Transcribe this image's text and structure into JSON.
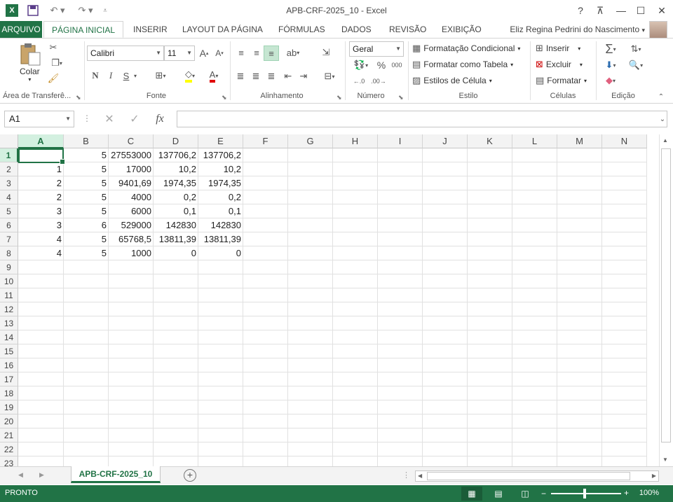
{
  "window": {
    "title": "APB-CRF-2025_10 - Excel",
    "help": "?",
    "restore_ribbon": "⊼",
    "minimize": "—",
    "maximize": "☐",
    "close": "✕"
  },
  "quick_access": {
    "save_icon": "save-icon",
    "undo_icon": "undo-icon",
    "redo_icon": "redo-icon"
  },
  "tabs": {
    "arquivo": "ARQUIVO",
    "items": [
      "PÁGINA INICIAL",
      "INSERIR",
      "LAYOUT DA PÁGINA",
      "FÓRMULAS",
      "DADOS",
      "REVISÃO",
      "EXIBIÇÃO"
    ],
    "user": "Eliz Regina Pedrini do Nascimento"
  },
  "ribbon": {
    "clipboard": {
      "paste": "Colar",
      "label": "Área de Transferê..."
    },
    "font": {
      "name": "Calibri",
      "size": "11",
      "bold": "N",
      "italic": "I",
      "underline": "S",
      "label": "Fonte"
    },
    "alignment": {
      "label": "Alinhamento"
    },
    "number": {
      "format": "Geral",
      "percent": "%",
      "thousands": "000",
      "label": "Número"
    },
    "styles": {
      "conditional": "Formatação Condicional",
      "table": "Formatar como Tabela",
      "cell_styles": "Estilos de Célula",
      "label": "Estilo"
    },
    "cells": {
      "insert": "Inserir",
      "delete": "Excluir",
      "format": "Formatar",
      "label": "Células"
    },
    "editing": {
      "label": "Edição"
    }
  },
  "formula_bar": {
    "name_box": "A1",
    "fx": "fx",
    "value": ""
  },
  "columns": [
    "A",
    "B",
    "C",
    "D",
    "E",
    "F",
    "G",
    "H",
    "I",
    "J",
    "K",
    "L",
    "M",
    "N"
  ],
  "rows": [
    "1",
    "2",
    "3",
    "4",
    "5",
    "6",
    "7",
    "8",
    "9",
    "10",
    "11",
    "12",
    "13",
    "14",
    "15",
    "16",
    "17",
    "18",
    "19",
    "20",
    "21",
    "22",
    "23"
  ],
  "cells": [
    [
      "",
      "5",
      "27553000",
      "137706,2",
      "137706,2"
    ],
    [
      "1",
      "5",
      "17000",
      "10,2",
      "10,2"
    ],
    [
      "2",
      "5",
      "9401,69",
      "1974,35",
      "1974,35"
    ],
    [
      "2",
      "5",
      "4000",
      "0,2",
      "0,2"
    ],
    [
      "3",
      "5",
      "6000",
      "0,1",
      "0,1"
    ],
    [
      "3",
      "6",
      "529000",
      "142830",
      "142830"
    ],
    [
      "4",
      "5",
      "65768,5",
      "13811,39",
      "13811,39"
    ],
    [
      "4",
      "5",
      "1000",
      "0",
      "0"
    ]
  ],
  "sheet_tab": "APB-CRF-2025_10",
  "status": {
    "text": "PRONTO",
    "zoom": "100%"
  },
  "colors": {
    "accent": "#217346"
  }
}
